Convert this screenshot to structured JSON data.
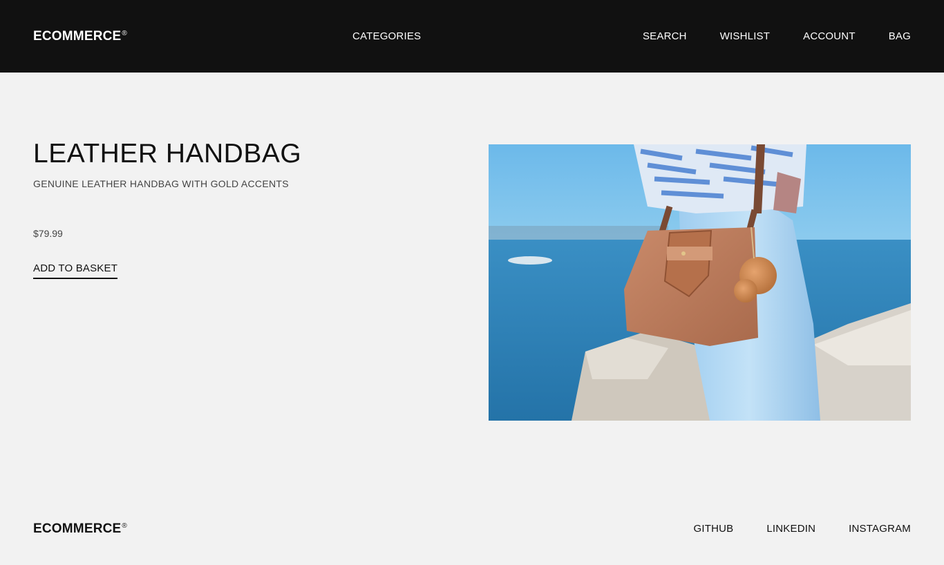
{
  "header": {
    "brand": "ECOMMERCE",
    "brand_mark": "®",
    "center_nav": "CATEGORIES",
    "right_nav": [
      "SEARCH",
      "WISHLIST",
      "ACCOUNT",
      "BAG"
    ]
  },
  "product": {
    "title": "LEATHER HANDBAG",
    "subtitle": "GENUINE LEATHER HANDBAG WITH GOLD ACCENTS",
    "price": "$79.99",
    "add_label": "ADD TO BASKET"
  },
  "footer": {
    "brand": "ECOMMERCE",
    "brand_mark": "®",
    "links": [
      "GITHUB",
      "LINKEDIN",
      "INSTAGRAM"
    ]
  },
  "colors": {
    "header_bg": "#111111",
    "page_bg": "#f2f2f2",
    "text": "#111111"
  }
}
